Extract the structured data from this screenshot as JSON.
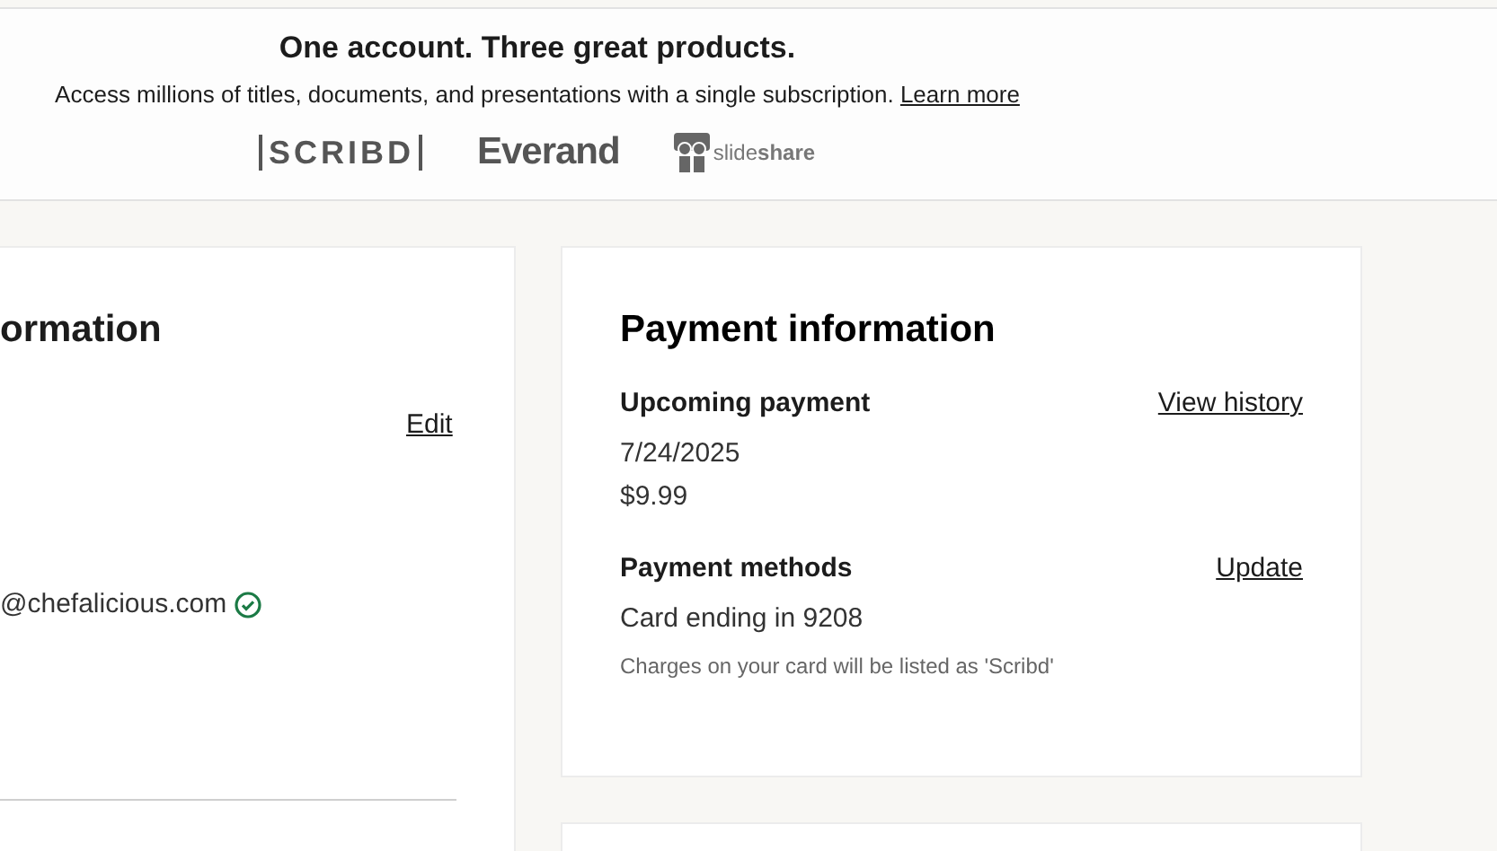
{
  "banner": {
    "title": "One account. Three great products.",
    "text": "Access millions of titles, documents, and presentations with a single subscription.",
    "link": "Learn more",
    "brands": [
      {
        "kind": "bracketed",
        "label": "SCRIBD"
      },
      {
        "kind": "wordmark",
        "label": "Everand"
      },
      {
        "kind": "iconmark",
        "label": "slide",
        "label_bold": "share"
      }
    ]
  },
  "account_card": {
    "title": "ormation",
    "edit": "Edit",
    "email": "@chefalicious.com",
    "verified": true
  },
  "payment_card": {
    "title": "Payment information",
    "sections": [
      {
        "heading": "Upcoming payment",
        "action": "View history",
        "lines": [
          "7/24/2025",
          "$9.99"
        ]
      },
      {
        "heading": "Payment methods",
        "action": "Update",
        "lines": [
          "Card ending in 9208"
        ],
        "note": "Charges on your card will be listed as 'Scribd'"
      }
    ]
  }
}
